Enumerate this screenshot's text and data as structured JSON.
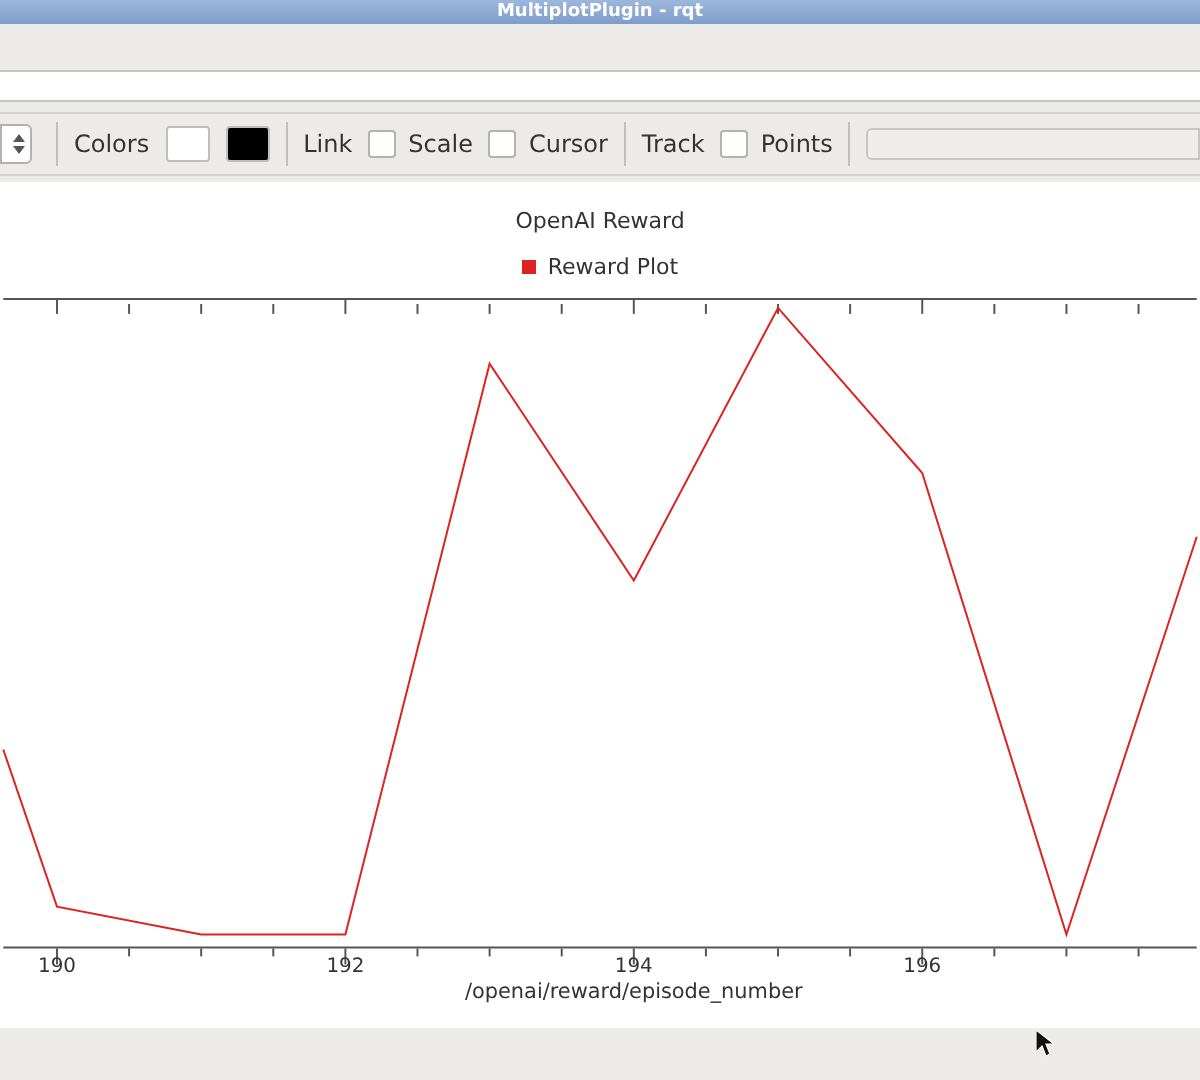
{
  "window": {
    "title": "MultiplotPlugin - rqt"
  },
  "toolbar": {
    "colors_label": "Colors",
    "swatches": [
      {
        "color": "#ffffff"
      },
      {
        "color": "#000000"
      }
    ],
    "options": [
      {
        "kind": "label",
        "label": "Link"
      },
      {
        "kind": "checkbox",
        "label": "Scale",
        "checked": false
      },
      {
        "kind": "checkbox",
        "label": "Cursor",
        "checked": false
      },
      {
        "kind": "divider"
      },
      {
        "kind": "label",
        "label": "Track"
      },
      {
        "kind": "checkbox",
        "label": "Points",
        "checked": false
      }
    ]
  },
  "plot": {
    "title": "OpenAI Reward",
    "legend": {
      "label": "Reward Plot",
      "color": "#dd2222"
    },
    "x_tick_labels": [
      "190",
      "192",
      "194",
      "196"
    ],
    "xlabel": "/openai/reward/episode_number"
  }
}
